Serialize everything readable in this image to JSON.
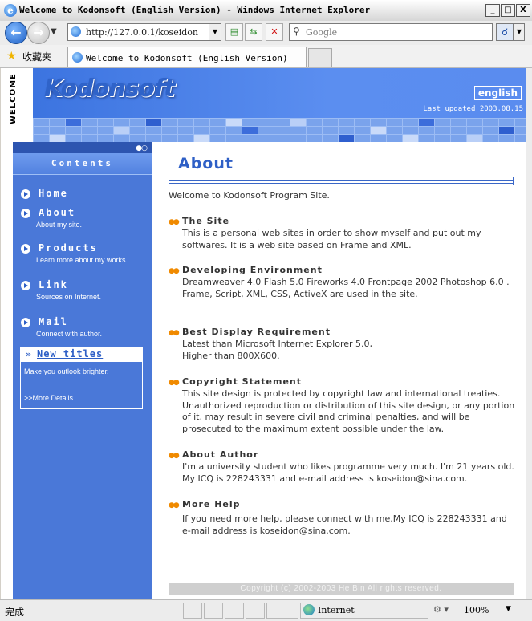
{
  "window": {
    "title": "Welcome to Kodonsoft (English Version) - Windows Internet Explorer",
    "minimize": "_",
    "maximize": "□",
    "close": "X"
  },
  "navbar": {
    "address": "http://127.0.0.1/koseidon",
    "search_placeholder": "Google"
  },
  "favbar": {
    "favorites_label": "收藏夹",
    "tab_title": "Welcome to Kodonsoft (English Version)"
  },
  "header": {
    "welcome": "WELCOME",
    "logo": "Kodonsoft",
    "language": "english",
    "last_updated": "Last updated 2003.08.15"
  },
  "sidebar": {
    "contents_title": "Contents",
    "items": [
      {
        "label": "Home",
        "sub": ""
      },
      {
        "label": "About",
        "sub": "About my site."
      },
      {
        "label": "Products",
        "sub": "Learn more about my works."
      },
      {
        "label": "Link",
        "sub": "Sources on Internet."
      },
      {
        "label": "Mail",
        "sub": "Connect with author."
      }
    ],
    "new_titles": {
      "title": "New titles",
      "body": "Make you outlook brighter.",
      "more": ">>More Details."
    }
  },
  "main": {
    "heading": "About",
    "intro": "Welcome to Kodonsoft Program Site.",
    "sections": [
      {
        "title": "The Site",
        "body": "This is a personal web sites in order to show myself and put out my softwares. It is a web site based on Frame and XML."
      },
      {
        "title": "Developing Environment",
        "body": "Dreamweaver 4.0 Flash 5.0 Fireworks 4.0 Frontpage 2002 Photoshop 6.0 .\nFrame, Script, XML, CSS, ActiveX are used in the site."
      },
      {
        "title": "Best Display Requirement",
        "body": "Latest than Microsoft Internet Explorer 5.0,\nHigher than 800X600."
      },
      {
        "title": "Copyright Statement",
        "body": "This site design is protected by copyright law and international treaties. Unauthorized reproduction or distribution of this site design, or any portion of it, may result in severe civil and criminal penalties, and will be prosecuted to the maximum extent possible under the law."
      },
      {
        "title": "About Author",
        "body": "I'm a university student who likes programme very much. I'm 21 years old. My ICQ is 228243331 and e-mail address is koseidon@sina.com."
      },
      {
        "title": "More Help",
        "body": "If you need more help, please connect with me.My ICQ is 228243331 and e-mail address is koseidon@sina.com."
      }
    ],
    "copyright": "Copyright (c) 2002-2003 He Bin All rights reserved."
  },
  "statusbar": {
    "status": "完成",
    "zone": "Internet",
    "zoom": "100%"
  }
}
